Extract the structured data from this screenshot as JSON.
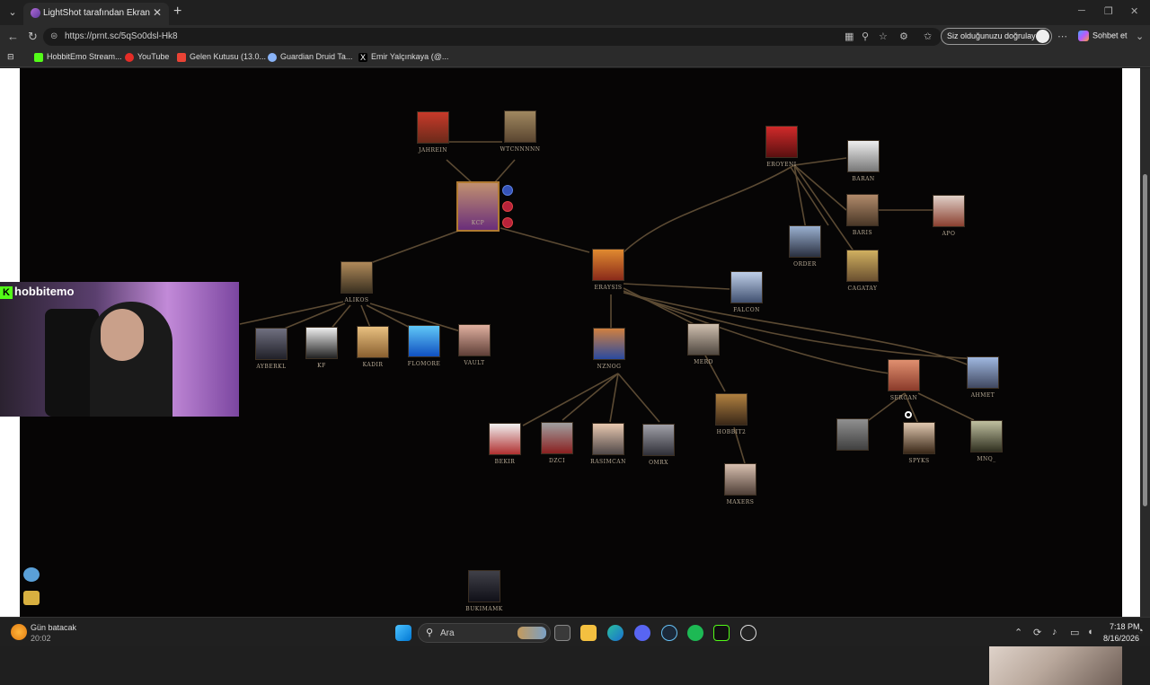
{
  "browser": {
    "tab_title": "LightShot tarafından Ekran Görüntüsü",
    "url": "https://prnt.sc/5qSo0dsl-Hk8",
    "verify_label": "Siz olduğunuzu doğrulayın",
    "chat_label": "Sohbet et",
    "bookmarks": [
      "HobbitEmo Stream...",
      "YouTube",
      "Gelen Kutusu (13.0...",
      "Guardian Druid Ta...",
      "Emir Yalçınkaya (@..."
    ]
  },
  "graph": {
    "nodes": {
      "jahrein": "JAHREIN",
      "wtcnnnnn": "WTCNNNNN",
      "kcp": "KCP",
      "eroyeni": "EROYENI",
      "baran": "BARAN",
      "baris": "BARIS",
      "apo": "APO",
      "order": "ORDER",
      "cagatay": "CAGATAY",
      "eray": "ERAYSIS",
      "falcon": "FALCON",
      "alikos": "ALIKOS",
      "ayberkl": "AYBERKL",
      "kf": "KF",
      "kadir": "KADIR",
      "flomore": "FLOMORE",
      "vault": "VAULT",
      "nznog": "NZNOG",
      "merd": "MERD",
      "sercan": "SERCAN",
      "ahmet": "AHMET",
      "hobbit2": "HOBBIT2",
      "bekir": "BEKIR",
      "dzci": "DZCI",
      "rasimcan": "RASIMCAN",
      "omrx": "OMRX",
      "spyks": "SPYKS",
      "mnq": "MNQ_",
      "maxers": "MAXERS",
      "bukimamk": "BUKIMAMK"
    }
  },
  "webcam": {
    "streamer_name": "hobbitemo"
  },
  "taskbar": {
    "weather_title": "Gün batacak",
    "weather_time": "20:02",
    "search_placeholder": "Ara",
    "clock_time": "7:18 PM",
    "clock_date": "8/16/2026"
  }
}
